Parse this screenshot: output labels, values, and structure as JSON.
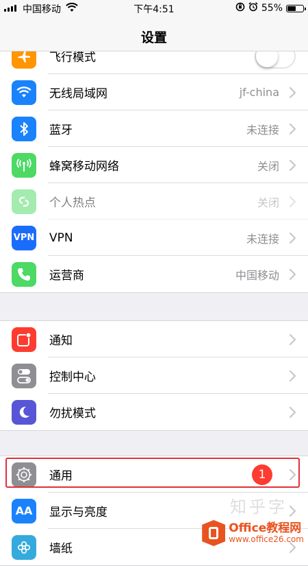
{
  "status_bar": {
    "carrier": "中国移动",
    "time": "下午4:51",
    "battery": "55%",
    "battery_level": 0.55
  },
  "nav": {
    "title": "设置"
  },
  "group1": [
    {
      "label": "飞行模式",
      "icon": "airplane-icon",
      "color": "#ff9500",
      "control": "toggle",
      "toggle_on": false
    },
    {
      "label": "无线局域网",
      "value": "jf-china",
      "icon": "wifi-icon",
      "color": "#1a82fb"
    },
    {
      "label": "蓝牙",
      "value": "未连接",
      "icon": "bluetooth-icon",
      "color": "#1a82fb"
    },
    {
      "label": "蜂窝移动网络",
      "value": "关闭",
      "icon": "cellular-icon",
      "color": "#4cd964"
    },
    {
      "label": "个人热点",
      "value": "关闭",
      "icon": "hotspot-icon",
      "color": "#4cd964",
      "disabled": true
    },
    {
      "label": "VPN",
      "value": "未连接",
      "icon": "vpn-icon",
      "icon_text": "VPN",
      "color": "#1a6dfb"
    },
    {
      "label": "运营商",
      "value": "中国移动",
      "icon": "phone-icon",
      "color": "#4cd964"
    }
  ],
  "group2": [
    {
      "label": "通知",
      "icon": "notification-icon",
      "color": "#fe3b30"
    },
    {
      "label": "控制中心",
      "icon": "control-center-icon",
      "color": "#8e8e93"
    },
    {
      "label": "勿扰模式",
      "icon": "moon-icon",
      "color": "#5856d6"
    }
  ],
  "group3": [
    {
      "label": "通用",
      "icon": "gear-icon",
      "color": "#8e8e93",
      "badge": "1",
      "highlighted": true
    },
    {
      "label": "显示与亮度",
      "icon": "display-icon",
      "icon_text": "AA",
      "color": "#1a82fb"
    },
    {
      "label": "墙纸",
      "icon": "wallpaper-icon",
      "color": "#35aadc"
    }
  ],
  "watermark": {
    "name": "Office教程网",
    "url": "www.office26.com",
    "faint": "知乎字"
  }
}
